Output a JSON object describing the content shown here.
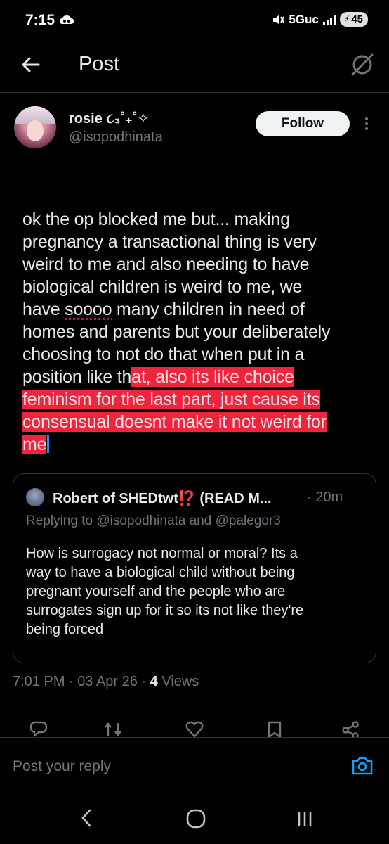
{
  "status_bar": {
    "time": "7:15",
    "network": "5Guc",
    "battery": "45"
  },
  "header": {
    "title": "Post"
  },
  "author": {
    "name": "rosie ૮₃˚₊˚✧",
    "handle": "@isopodhinata",
    "follow_label": "Follow"
  },
  "post": {
    "lines": [
      {
        "plain": "ok the op blocked me but... making",
        "highlight": ""
      },
      {
        "plain": "pregnancy a transactional thing is very",
        "highlight": ""
      },
      {
        "plain": "weird to me and also needing to have",
        "highlight": ""
      },
      {
        "plain": "biological children is weird to me, we",
        "highlight": ""
      },
      {
        "plain_before": "have ",
        "misspelled": "soooo",
        "plain_after": " many children in need of"
      },
      {
        "plain": "homes and parents but your deliberately",
        "highlight": ""
      },
      {
        "plain": "choosing to not do that when put in a",
        "highlight": ""
      },
      {
        "plain": "position like th",
        "highlight": "at, also its like choice"
      },
      {
        "plain": "",
        "highlight": "feminism for the last part, just cause its"
      },
      {
        "plain": "",
        "highlight": "consensual doesnt make it not weird for"
      },
      {
        "plain": "",
        "highlight": "me"
      }
    ]
  },
  "quote": {
    "author": "Robert of SHEDtwt⁉️ (READ M...",
    "time": "· 20m",
    "replying_to": "Replying to @isopodhinata and @palegor3",
    "lines": [
      "How is surrogacy not normal or moral? Its a",
      "way to have a biological child without being",
      "pregnant yourself and the people who are",
      "surrogates sign up for it so its not like they're",
      "being forced"
    ]
  },
  "meta": {
    "time_date": "7:01 PM · 03 Apr 26 · ",
    "views_count": "4",
    "views_label": " Views"
  },
  "reply": {
    "placeholder": "Post your reply"
  },
  "colors": {
    "background": "#000000",
    "text": "#e7e9ea",
    "muted": "#71767b",
    "highlight": "#f1243d",
    "accent": "#1d9bf0"
  }
}
